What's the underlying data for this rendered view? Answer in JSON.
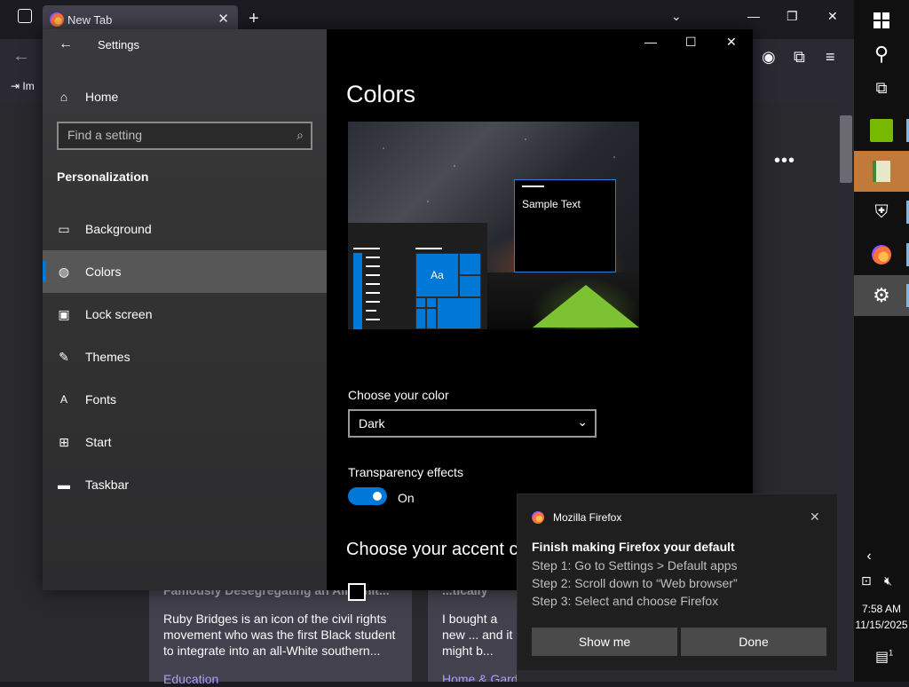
{
  "firefox": {
    "tab_title": "New Tab",
    "new_tab": "+",
    "import_label": "Im",
    "cards": [
      {
        "title": "Famously Desegregating an All-Whit...",
        "body": "Ruby Bridges is an icon of the civil rights movement who was the first Black student to integrate into an all-White southern...",
        "category": "Education"
      },
      {
        "title": "...tically Home Depo...",
        "body": "I bought a new ... and it might b... gotten myself...",
        "category": "Home & Garden"
      }
    ]
  },
  "settings": {
    "window_title": "Settings",
    "home_label": "Home",
    "search_placeholder": "Find a setting",
    "section_title": "Personalization",
    "nav": [
      {
        "label": "Background",
        "icon": "picture-icon",
        "active": false
      },
      {
        "label": "Colors",
        "icon": "palette-icon",
        "active": true
      },
      {
        "label": "Lock screen",
        "icon": "lock-screen-icon",
        "active": false
      },
      {
        "label": "Themes",
        "icon": "themes-icon",
        "active": false
      },
      {
        "label": "Fonts",
        "icon": "fonts-icon",
        "active": false
      },
      {
        "label": "Start",
        "icon": "start-icon",
        "active": false
      },
      {
        "label": "Taskbar",
        "icon": "taskbar-icon",
        "active": false
      }
    ],
    "page_title": "Colors",
    "preview": {
      "sample_text": "Sample Text",
      "tile_text": "Aa"
    },
    "choose_color_label": "Choose your color",
    "choose_color_value": "Dark",
    "transparency_label": "Transparency effects",
    "transparency_state": "On",
    "transparency_on": true,
    "accent_heading": "Choose your accent co",
    "accent_color": "#0078d7"
  },
  "notification": {
    "app_name": "Mozilla Firefox",
    "title": "Finish making Firefox your default",
    "steps": [
      "Step 1: Go to Settings > Default apps",
      "Step 2: Scroll down to “Web browser”",
      "Step 3: Select and choose Firefox"
    ],
    "show_me": "Show me",
    "done": "Done"
  },
  "taskbar": {
    "time": "7:58 AM",
    "date": "11/15/2025",
    "notification_count": "1"
  }
}
